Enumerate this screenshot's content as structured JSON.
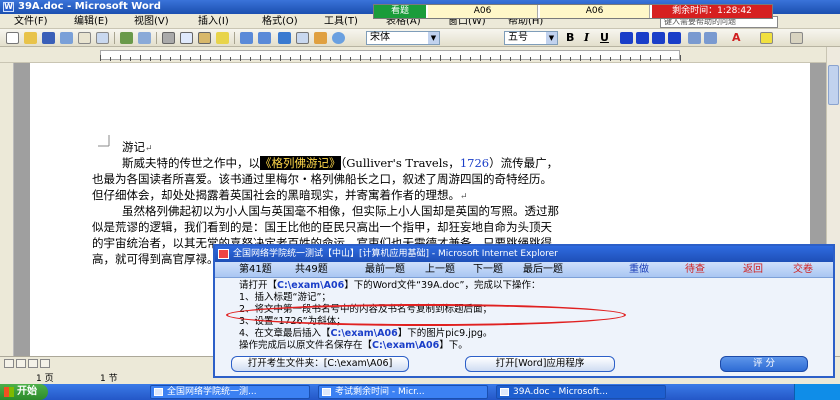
{
  "word": {
    "title": "39A.doc - Microsoft Word",
    "menu": [
      "文件(F)",
      "编辑(E)",
      "视图(V)",
      "插入(I)",
      "格式(O)",
      "工具(T)",
      "表格(A)",
      "窗口(W)",
      "帮助(H)"
    ],
    "ask_placeholder": "键入需要帮助的问题",
    "font_name": "宋体",
    "font_size": "五号",
    "format_bold": "B",
    "format_italic": "I",
    "format_underline": "U",
    "font_color_letter": "A"
  },
  "exam_bar": {
    "label": "看题",
    "field_a": "A06",
    "field_b": "A06",
    "time_remaining": "剩余时间：1:28:42"
  },
  "document": {
    "lines": [
      {
        "text": "游记"
      },
      {
        "pre": "斯威夫特的传世之作中，以",
        "hl": "《格列佛游记》",
        "mid": "（Gulliver's Travels，",
        "num": "1726",
        "post": "）流传最广，"
      },
      {
        "text": "也最为各国读者所喜爱。该书通过里梅尔・格列佛船长之口，叙述了周游四国的奇特经历。"
      },
      {
        "text": "但仔细体会，却处处揭露着英国社会的黑暗现实，并寄寓着作者的理想。"
      },
      {
        "text": "虽然格列佛起初以为小人国与英国毫不相像，但实际上小人国却是英国的写照。透过那"
      },
      {
        "text": "似是荒谬的逻辑，我们看到的是：国王比他的臣民只高出一个指甲，却狂妄地自命为头顶天"
      },
      {
        "text": "的宇宙统治者，以其无常的喜怒决定老百姓的命运。官吏们也无需德才兼备，只要跳绳跳得"
      },
      {
        "text": "高，就可得到高官厚禄。"
      }
    ]
  },
  "status": {
    "page": "1 页",
    "section": "1 节"
  },
  "taskbar": {
    "start": "开始",
    "tasks": [
      "全国网络学院统一测...",
      "考试剩余时间 - Micr...",
      "39A.doc - Microsoft..."
    ]
  },
  "panel": {
    "title": "全国网络学院统一测试【中山】[计算机应用基础] - Microsoft Internet Explorer",
    "nav": {
      "current_pre": "第",
      "current_num": "41",
      "current_suf": "题",
      "total_pre": "共",
      "total_num": "49",
      "total_suf": "题",
      "prev": "上一题",
      "first": "最前一题",
      "next": "下一题",
      "last": "最后一题",
      "redo": "重做",
      "pending": "待查",
      "back": "返回",
      "submit": "交卷"
    },
    "instructions": {
      "line1_pre": "请打开【",
      "path": "C:\\exam\\A06",
      "line1_post": "】下的Word文件“39A.doc”，完成以下操作：",
      "item1": "1、插入标题“游记”；",
      "item2": "2、将文中第一段书名号中的内容及书名号复制到标题后面；",
      "item3": "3、设置“1726”为斜体；",
      "item4_pre": "4、在文章最后插入【",
      "item4_post": "】下的图片pic9.jpg。",
      "line6_pre": "操作完成后以原文件名保存在【",
      "line6_post": "】下。"
    },
    "buttons": {
      "open_folder": "打开考生文件夹：[C:\\exam\\A06]",
      "open_word": "打开[Word]应用程序",
      "score": "评 分"
    }
  },
  "colors": {
    "title_blue": "#1b4fb0",
    "highlight_bg": "#000000",
    "highlight_fg": "#ffd84a",
    "annotation_red": "#e02020",
    "exam_green": "#1a9c3a"
  }
}
